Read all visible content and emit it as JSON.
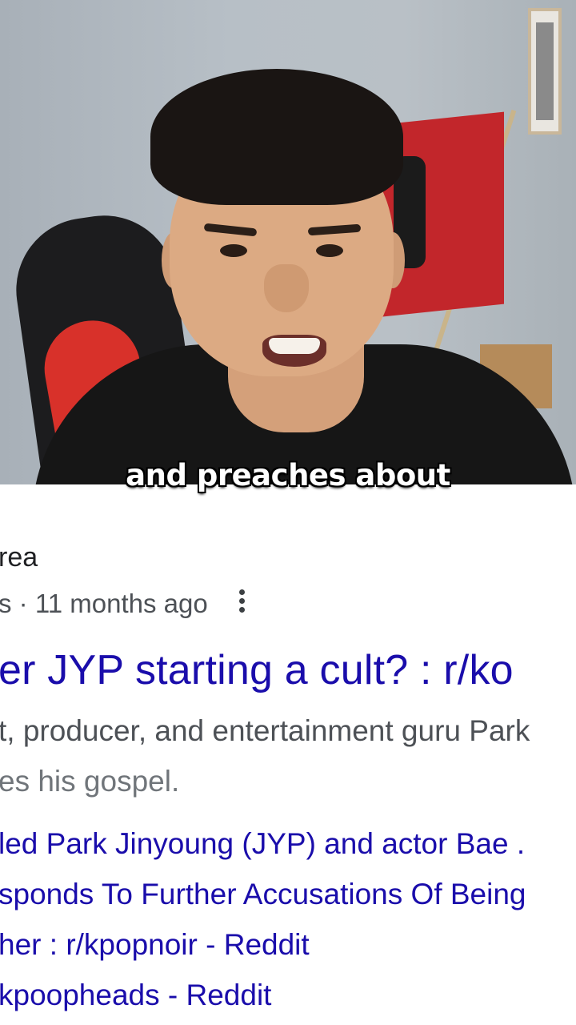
{
  "video": {
    "caption": "and preaches about"
  },
  "result": {
    "site_name": "rea",
    "meta_text": "s · 11 months ago",
    "more_icon": "vertical-dots-icon",
    "title": "er JYP starting a cult? : r/ko",
    "snippet_line1": "t, producer, and entertainment guru Park",
    "snippet_line2": "es his gospel.",
    "related_links": [
      {
        "text": "led Park Jinyoung (JYP) and actor Bae ."
      },
      {
        "text": "sponds To Further Accusations Of Being"
      },
      {
        "text": "her : r/kpopnoir - Reddit"
      },
      {
        "text": "kpoopheads - Reddit"
      }
    ]
  },
  "colors": {
    "link": "#1a0dab",
    "snippet": "#4d5156",
    "caption_text": "#ffffff",
    "caption_outline": "#000000"
  }
}
